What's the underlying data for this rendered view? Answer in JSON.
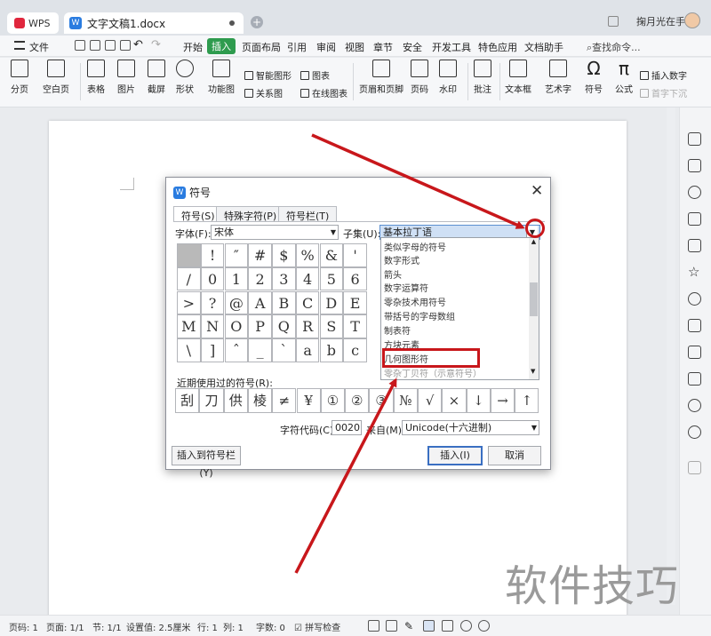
{
  "app": {
    "brand": "WPS",
    "doc_tab": "文字文稿1.docx",
    "user": "掬月光在手"
  },
  "menu": {
    "file": "文件",
    "items": [
      "开始",
      "插入",
      "页面布局",
      "引用",
      "审阅",
      "视图",
      "章节",
      "安全",
      "开发工具",
      "特色应用",
      "文档助手"
    ],
    "active": "插入",
    "search": "查找命令..."
  },
  "ribbon": {
    "big": [
      "分页",
      "空白页",
      "表格",
      "图片",
      "截屏",
      "形状",
      "功能图",
      "页眉和页脚",
      "页码",
      "水印",
      "批注",
      "文本框",
      "艺术字",
      "符号",
      "公式"
    ],
    "small": [
      "智能图形",
      "图表",
      "关系图",
      "在线图表",
      "插入数字",
      "首字下沉"
    ]
  },
  "dialog": {
    "title": "符号",
    "tabs": [
      "符号(S)",
      "特殊字符(P)",
      "符号栏(T)"
    ],
    "font_label": "字体(F):",
    "font_value": "宋体",
    "subset_label": "子集(U):",
    "subset_value": "基本拉丁语",
    "symbols": [
      "",
      "!",
      "″",
      "#",
      "$",
      "%",
      "&",
      "'",
      "/",
      "0",
      "1",
      "2",
      "3",
      "4",
      "5",
      "6",
      ">",
      "?",
      "@",
      "A",
      "B",
      "C",
      "D",
      "E",
      "M",
      "N",
      "O",
      "P",
      "Q",
      "R",
      "S",
      "T",
      "\\",
      "]",
      "ˆ",
      "_",
      "`",
      "a",
      "b",
      "c"
    ],
    "subset_options": [
      "类似字母的符号",
      "数字形式",
      "箭头",
      "数字运算符",
      "零杂技术用符号",
      "带括号的字母数组",
      "制表符",
      "方块元素",
      "几何图形符",
      "零杂丁贝符（示意符号）"
    ],
    "recent_label": "近期使用过的符号(R):",
    "recent": [
      "刮",
      "刀",
      "供",
      "棱",
      "≠",
      "¥",
      "①",
      "②",
      "③",
      "№",
      "√",
      "×",
      "↓",
      "→",
      "↑"
    ],
    "code_label": "字符代码(C):",
    "code_value": "0020",
    "from_label": "来自(M)",
    "from_value": "Unicode(十六进制)",
    "insert_to_bar": "插入到符号栏(Y)",
    "insert": "插入(I)",
    "cancel": "取消"
  },
  "status": {
    "page": "页码: 1",
    "pages": "页面: 1/1",
    "section": "节: 1/1",
    "setting": "设置值: 2.5厘米",
    "row": "行: 1",
    "col": "列: 1",
    "words": "字数: 0",
    "spell": "拼写检查"
  },
  "watermark": "软件技巧",
  "colors": {
    "accent": "#2e9b4e",
    "annotation": "#c8171b",
    "dialog_blue": "#2a7ce0"
  }
}
